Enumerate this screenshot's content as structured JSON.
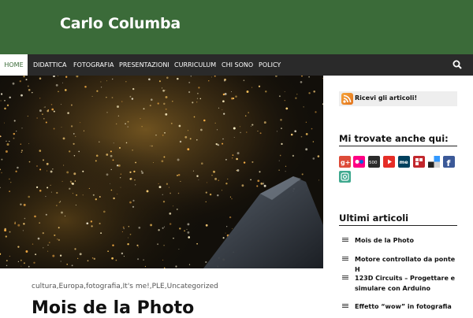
{
  "site": {
    "title": "Carlo Columba"
  },
  "nav": {
    "items": [
      {
        "label": "Home",
        "active": true
      },
      {
        "label": "Didattica"
      },
      {
        "label": "Fotografia"
      },
      {
        "label": "Presentazioni"
      },
      {
        "label": "Curriculum"
      },
      {
        "label": "Chi sono"
      },
      {
        "label": "Policy"
      }
    ],
    "search_icon": "search-icon"
  },
  "colors": {
    "header_bg": "#3b6b39",
    "nav_bg": "#2a2a2a",
    "accent": "#3b6b39"
  },
  "hero": {
    "image": "night aerial city lights from airplane window"
  },
  "post": {
    "categories": "cultura,Europa,fotografia,It's me!,PLE,Uncategorized",
    "title": "Mois de la Photo"
  },
  "sidebar": {
    "rss_label": "Ricevi gli articoli!",
    "social_title": "Mi trovate anche qui:",
    "social_icons": [
      "google-plus-icon",
      "flickr-icon",
      "500px-icon",
      "youtube-icon",
      "about-me-icon",
      "flipboard-icon",
      "delicious-icon",
      "facebook-icon",
      "instagram-icon"
    ],
    "recent_title": "Ultimi articoli",
    "recent": [
      "Mois de la Photo",
      "Motore controllato da ponte H",
      "123D Circuits – Progettare e simulare con Arduino",
      "Effetto “wow” in fotografia"
    ]
  }
}
